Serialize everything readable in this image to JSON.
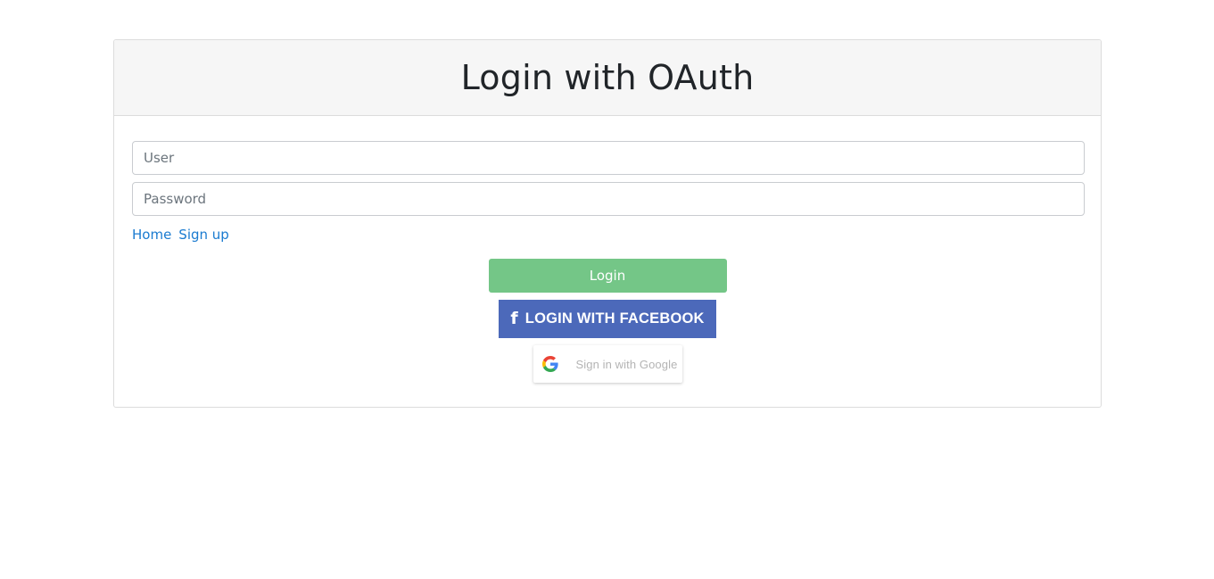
{
  "header": {
    "title": "Login with OAuth"
  },
  "form": {
    "user_placeholder": "User",
    "password_placeholder": "Password"
  },
  "links": {
    "home": "Home",
    "signup": "Sign up"
  },
  "buttons": {
    "login": "Login",
    "facebook": "LOGIN WITH FACEBOOK",
    "google": "Sign in with Google"
  },
  "icons": {
    "facebook": "facebook-f-icon",
    "google": "google-g-icon"
  },
  "colors": {
    "login_button": "#74c687",
    "facebook_button": "#4c69ba",
    "link": "#1a7bd0"
  }
}
